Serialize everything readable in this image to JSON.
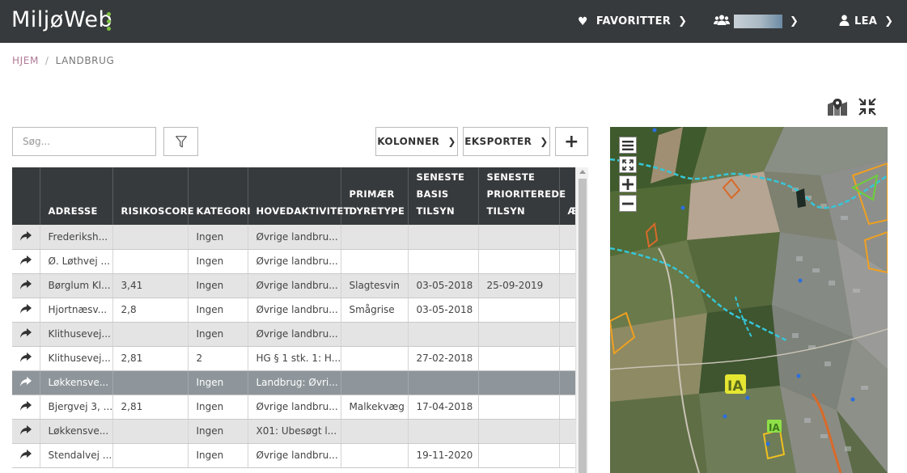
{
  "header": {
    "logo": "MiljøWeb",
    "favorites_label": "FAVORITTER",
    "user_label": "LEA"
  },
  "breadcrumb": {
    "home": "HJEM",
    "separator": "/",
    "current": "LANDBRUG"
  },
  "toolbar": {
    "search_placeholder": "Søg...",
    "columns_label": "KOLONNER",
    "export_label": "EKSPORTER",
    "add_label": "+"
  },
  "table": {
    "headers": {
      "address": "ADRESSE",
      "risk": "RISIKOSCORE",
      "category": "KATEGORI",
      "main_activity": "HOVEDAKTIVITET",
      "animal_type_1": "PRIMÆR",
      "animal_type_2": "DYRETYPE",
      "basic_1": "SENESTE",
      "basic_2": "BASIS",
      "basic_3": "TILSYN",
      "prio_1": "SENESTE",
      "prio_2": "PRIORITEREDE",
      "prio_3": "TILSYN",
      "extra": "Æ"
    },
    "rows": [
      {
        "address": "Frederiksh...",
        "risk": "",
        "category": "Ingen",
        "activity": "Øvrige landbru...",
        "animal": "",
        "basic": "",
        "prio": ""
      },
      {
        "address": "Ø. Løthvej ...",
        "risk": "",
        "category": "Ingen",
        "activity": "Øvrige landbru...",
        "animal": "",
        "basic": "",
        "prio": ""
      },
      {
        "address": "Børglum Kl...",
        "risk": "3,41",
        "category": "Ingen",
        "activity": "Øvrige landbru...",
        "animal": "Slagtesvin",
        "basic": "03-05-2018",
        "prio": "25-09-2019"
      },
      {
        "address": "Hjortnæsv...",
        "risk": "2,8",
        "category": "Ingen",
        "activity": "Øvrige landbru...",
        "animal": "Smågrise",
        "basic": "03-05-2018",
        "prio": ""
      },
      {
        "address": "Klithusevej...",
        "risk": "",
        "category": "Ingen",
        "activity": "Øvrige landbru...",
        "animal": "",
        "basic": "",
        "prio": ""
      },
      {
        "address": "Klithusevej...",
        "risk": "2,81",
        "category": "2",
        "activity": "HG § 1 stk. 1: H...",
        "animal": "",
        "basic": "27-02-2018",
        "prio": ""
      },
      {
        "address": "Løkkensve...",
        "risk": "",
        "category": "Ingen",
        "activity": "Landbrug: Øvri...",
        "animal": "",
        "basic": "",
        "prio": ""
      },
      {
        "address": "Bjergvej 3, ...",
        "risk": "2,81",
        "category": "Ingen",
        "activity": "Øvrige landbru...",
        "animal": "Malkekvæg",
        "basic": "17-04-2018",
        "prio": ""
      },
      {
        "address": "Løkkensve...",
        "risk": "",
        "category": "Ingen",
        "activity": "X01: Ubesøgt l...",
        "animal": "",
        "basic": "",
        "prio": ""
      },
      {
        "address": "Stendalvej ...",
        "risk": "",
        "category": "Ingen",
        "activity": "Øvrige landbru...",
        "animal": "",
        "basic": "19-11-2020",
        "prio": ""
      }
    ]
  },
  "colors": {
    "header_bg": "#373a3c",
    "logo_accent": "#7ec142",
    "breadcrumb_home": "#b07b98",
    "selected_row": "#8e969b"
  },
  "icons": {
    "favorites": "heart-icon",
    "team": "users-icon",
    "user": "user-icon",
    "filter": "filter-icon",
    "row_action": "share-arrow-icon",
    "map_toggle": "map-marker-icon",
    "collapse": "compress-icon"
  }
}
